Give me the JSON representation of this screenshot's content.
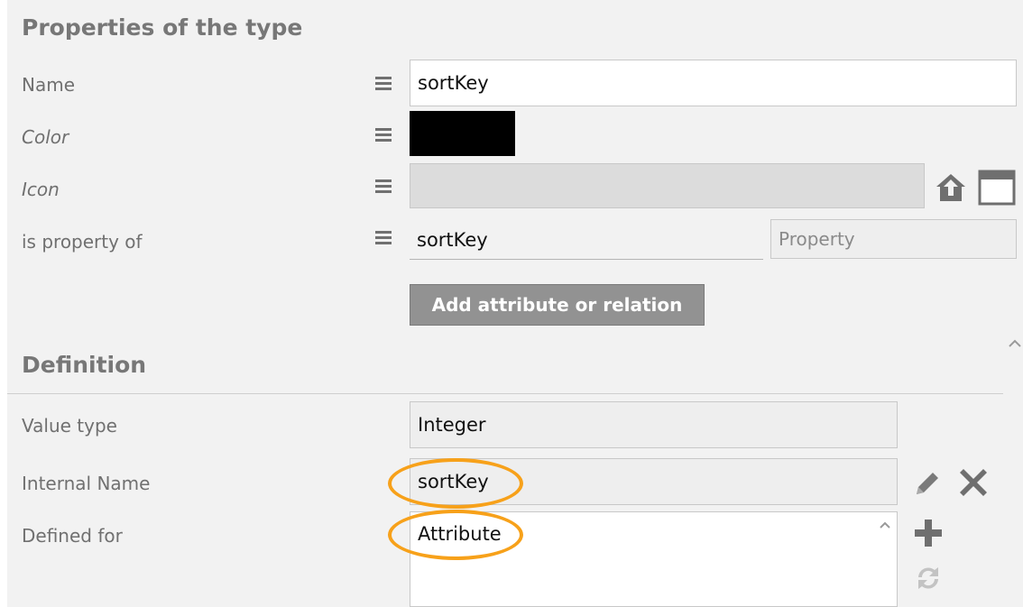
{
  "sections": {
    "properties_title": "Properties of the type",
    "definition_title": "Definition"
  },
  "fields": {
    "name_label": "Name",
    "name_value": "sortKey",
    "color_label": "Color",
    "color_value_hex": "#000000",
    "icon_label": "Icon",
    "icon_value": "",
    "property_of_label": "is property of",
    "property_of_value": "sortKey",
    "property_of_type": "Property",
    "add_button": "Add attribute or relation"
  },
  "definition": {
    "value_type_label": "Value type",
    "value_type_value": "Integer",
    "internal_name_label": "Internal Name",
    "internal_name_value": "sortKey",
    "defined_for_label": "Defined for",
    "defined_for_items": [
      "Attribute"
    ]
  },
  "icons": [
    "menu-icon",
    "house-upload-icon",
    "window-icon",
    "pencil-icon",
    "delete-x-icon",
    "plus-icon",
    "refresh-icon",
    "scroll-up-icon"
  ],
  "colors": {
    "highlight_ring": "#f7a11a",
    "button": "#929292"
  }
}
